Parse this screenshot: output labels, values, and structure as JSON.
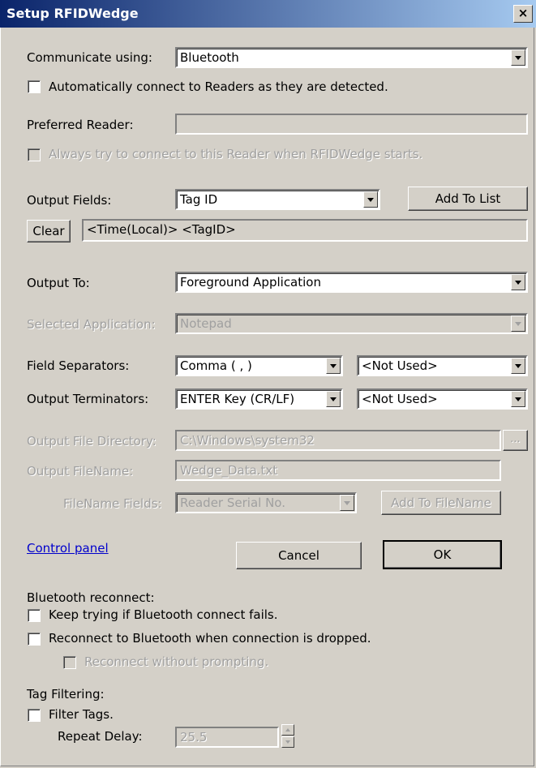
{
  "window": {
    "title": "Setup RFIDWedge",
    "close_label": "×"
  },
  "communicate": {
    "label": "Communicate using:",
    "value": "Bluetooth"
  },
  "auto_connect": {
    "label": "Automatically connect to Readers as they are detected.",
    "checked": false
  },
  "preferred_reader": {
    "label": "Preferred Reader:",
    "value": ""
  },
  "always_connect": {
    "label": "Always try to connect to this Reader when RFIDWedge starts.",
    "checked": false
  },
  "output_fields": {
    "label": "Output Fields:",
    "value": "Tag ID",
    "add_button": "Add To List"
  },
  "field_list": {
    "clear_button": "Clear",
    "value": "<Time(Local)> <TagID>"
  },
  "output_to": {
    "label": "Output To:",
    "value": "Foreground Application"
  },
  "selected_app": {
    "label": "Selected Application:",
    "value": "Notepad"
  },
  "separators": {
    "label": "Field Separators:",
    "value1": "Comma ( , )",
    "value2": "<Not Used>"
  },
  "terminators": {
    "label": "Output Terminators:",
    "value1": "ENTER Key (CR/LF)",
    "value2": "<Not Used>"
  },
  "output_dir": {
    "label": "Output File Directory:",
    "value": "C:\\Windows\\system32",
    "browse_label": "..."
  },
  "output_filename": {
    "label": "Output FileName:",
    "value": "Wedge_Data.txt"
  },
  "filename_fields": {
    "label": "FileName Fields:",
    "value": "Reader Serial No.",
    "add_button": "Add To FileName"
  },
  "footer": {
    "control_panel": "Control panel",
    "cancel": "Cancel",
    "ok": "OK"
  },
  "bluetooth": {
    "heading": "Bluetooth reconnect:",
    "keep_trying": "Keep trying if Bluetooth connect fails.",
    "reconnect_dropped": "Reconnect to Bluetooth when connection is dropped.",
    "no_prompt": "Reconnect without prompting."
  },
  "filtering": {
    "heading": "Tag Filtering:",
    "filter_tags": "Filter Tags.",
    "repeat_delay_label": "Repeat Delay:",
    "repeat_delay_value": "25.5"
  }
}
